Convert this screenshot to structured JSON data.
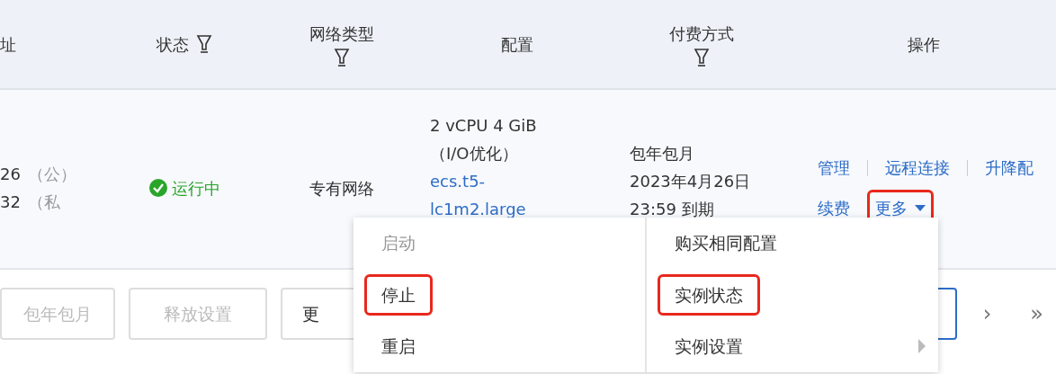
{
  "table": {
    "columns": [
      {
        "label": "址",
        "filter": false
      },
      {
        "label": "状态",
        "filter": true
      },
      {
        "label": "网络类型",
        "filter": true
      },
      {
        "label": "配置",
        "filter": false
      },
      {
        "label": "付费方式",
        "filter": true
      },
      {
        "label": "操作",
        "filter": false
      }
    ],
    "rows": [
      {
        "address": [
          {
            "value": "26",
            "tag": "（公）"
          },
          {
            "value": "32",
            "tag": "（私"
          }
        ],
        "status": {
          "text": "运行中",
          "kind": "running"
        },
        "network": "专有网络",
        "config": {
          "spec": "2 vCPU 4 GiB",
          "note": "（I/O优化）",
          "type_link": [
            "ecs.t5-",
            "lc1m2.large"
          ]
        },
        "payment": [
          "包年包月",
          "2023年4月26日",
          "23:59 到期"
        ],
        "actions": [
          [
            {
              "label": "管理",
              "kind": "link",
              "highlighted": false
            },
            {
              "label": "远程连接",
              "kind": "link",
              "highlighted": false
            },
            {
              "label": "升降配",
              "kind": "link",
              "highlighted": false
            }
          ],
          [
            {
              "label": "续费",
              "kind": "link",
              "highlighted": false
            },
            {
              "label": "更多",
              "kind": "dropdown",
              "highlighted": true
            }
          ]
        ]
      }
    ]
  },
  "toolbar": {
    "buttons": [
      {
        "label": "包年包月",
        "disabled": true
      },
      {
        "label": "释放设置",
        "disabled": true
      },
      {
        "label": "更",
        "disabled": false
      }
    ],
    "pagination": [
      {
        "label": "›"
      },
      {
        "label": "»"
      }
    ]
  },
  "menu": {
    "panels": [
      [
        {
          "label": "启动",
          "disabled": true,
          "highlighted": false,
          "submenu": false
        },
        {
          "label": "停止",
          "disabled": false,
          "highlighted": true,
          "submenu": false
        },
        {
          "label": "重启",
          "disabled": false,
          "highlighted": false,
          "submenu": false
        }
      ],
      [
        {
          "label": "购买相同配置",
          "disabled": false,
          "highlighted": false,
          "submenu": false
        },
        {
          "label": "实例状态",
          "disabled": false,
          "highlighted": true,
          "submenu": false
        },
        {
          "label": "实例设置",
          "disabled": false,
          "highlighted": false,
          "submenu": true
        }
      ]
    ]
  }
}
